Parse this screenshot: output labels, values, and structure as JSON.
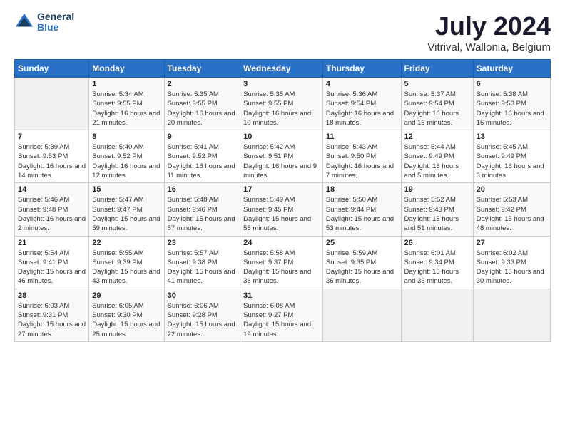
{
  "logo": {
    "line1": "General",
    "line2": "Blue"
  },
  "title": "July 2024",
  "subtitle": "Vitrival, Wallonia, Belgium",
  "headers": [
    "Sunday",
    "Monday",
    "Tuesday",
    "Wednesday",
    "Thursday",
    "Friday",
    "Saturday"
  ],
  "weeks": [
    [
      {
        "day": "",
        "sunrise": "",
        "sunset": "",
        "daylight": ""
      },
      {
        "day": "1",
        "sunrise": "Sunrise: 5:34 AM",
        "sunset": "Sunset: 9:55 PM",
        "daylight": "Daylight: 16 hours and 21 minutes."
      },
      {
        "day": "2",
        "sunrise": "Sunrise: 5:35 AM",
        "sunset": "Sunset: 9:55 PM",
        "daylight": "Daylight: 16 hours and 20 minutes."
      },
      {
        "day": "3",
        "sunrise": "Sunrise: 5:35 AM",
        "sunset": "Sunset: 9:55 PM",
        "daylight": "Daylight: 16 hours and 19 minutes."
      },
      {
        "day": "4",
        "sunrise": "Sunrise: 5:36 AM",
        "sunset": "Sunset: 9:54 PM",
        "daylight": "Daylight: 16 hours and 18 minutes."
      },
      {
        "day": "5",
        "sunrise": "Sunrise: 5:37 AM",
        "sunset": "Sunset: 9:54 PM",
        "daylight": "Daylight: 16 hours and 16 minutes."
      },
      {
        "day": "6",
        "sunrise": "Sunrise: 5:38 AM",
        "sunset": "Sunset: 9:53 PM",
        "daylight": "Daylight: 16 hours and 15 minutes."
      }
    ],
    [
      {
        "day": "7",
        "sunrise": "Sunrise: 5:39 AM",
        "sunset": "Sunset: 9:53 PM",
        "daylight": "Daylight: 16 hours and 14 minutes."
      },
      {
        "day": "8",
        "sunrise": "Sunrise: 5:40 AM",
        "sunset": "Sunset: 9:52 PM",
        "daylight": "Daylight: 16 hours and 12 minutes."
      },
      {
        "day": "9",
        "sunrise": "Sunrise: 5:41 AM",
        "sunset": "Sunset: 9:52 PM",
        "daylight": "Daylight: 16 hours and 11 minutes."
      },
      {
        "day": "10",
        "sunrise": "Sunrise: 5:42 AM",
        "sunset": "Sunset: 9:51 PM",
        "daylight": "Daylight: 16 hours and 9 minutes."
      },
      {
        "day": "11",
        "sunrise": "Sunrise: 5:43 AM",
        "sunset": "Sunset: 9:50 PM",
        "daylight": "Daylight: 16 hours and 7 minutes."
      },
      {
        "day": "12",
        "sunrise": "Sunrise: 5:44 AM",
        "sunset": "Sunset: 9:49 PM",
        "daylight": "Daylight: 16 hours and 5 minutes."
      },
      {
        "day": "13",
        "sunrise": "Sunrise: 5:45 AM",
        "sunset": "Sunset: 9:49 PM",
        "daylight": "Daylight: 16 hours and 3 minutes."
      }
    ],
    [
      {
        "day": "14",
        "sunrise": "Sunrise: 5:46 AM",
        "sunset": "Sunset: 9:48 PM",
        "daylight": "Daylight: 16 hours and 2 minutes."
      },
      {
        "day": "15",
        "sunrise": "Sunrise: 5:47 AM",
        "sunset": "Sunset: 9:47 PM",
        "daylight": "Daylight: 15 hours and 59 minutes."
      },
      {
        "day": "16",
        "sunrise": "Sunrise: 5:48 AM",
        "sunset": "Sunset: 9:46 PM",
        "daylight": "Daylight: 15 hours and 57 minutes."
      },
      {
        "day": "17",
        "sunrise": "Sunrise: 5:49 AM",
        "sunset": "Sunset: 9:45 PM",
        "daylight": "Daylight: 15 hours and 55 minutes."
      },
      {
        "day": "18",
        "sunrise": "Sunrise: 5:50 AM",
        "sunset": "Sunset: 9:44 PM",
        "daylight": "Daylight: 15 hours and 53 minutes."
      },
      {
        "day": "19",
        "sunrise": "Sunrise: 5:52 AM",
        "sunset": "Sunset: 9:43 PM",
        "daylight": "Daylight: 15 hours and 51 minutes."
      },
      {
        "day": "20",
        "sunrise": "Sunrise: 5:53 AM",
        "sunset": "Sunset: 9:42 PM",
        "daylight": "Daylight: 15 hours and 48 minutes."
      }
    ],
    [
      {
        "day": "21",
        "sunrise": "Sunrise: 5:54 AM",
        "sunset": "Sunset: 9:41 PM",
        "daylight": "Daylight: 15 hours and 46 minutes."
      },
      {
        "day": "22",
        "sunrise": "Sunrise: 5:55 AM",
        "sunset": "Sunset: 9:39 PM",
        "daylight": "Daylight: 15 hours and 43 minutes."
      },
      {
        "day": "23",
        "sunrise": "Sunrise: 5:57 AM",
        "sunset": "Sunset: 9:38 PM",
        "daylight": "Daylight: 15 hours and 41 minutes."
      },
      {
        "day": "24",
        "sunrise": "Sunrise: 5:58 AM",
        "sunset": "Sunset: 9:37 PM",
        "daylight": "Daylight: 15 hours and 38 minutes."
      },
      {
        "day": "25",
        "sunrise": "Sunrise: 5:59 AM",
        "sunset": "Sunset: 9:35 PM",
        "daylight": "Daylight: 15 hours and 36 minutes."
      },
      {
        "day": "26",
        "sunrise": "Sunrise: 6:01 AM",
        "sunset": "Sunset: 9:34 PM",
        "daylight": "Daylight: 15 hours and 33 minutes."
      },
      {
        "day": "27",
        "sunrise": "Sunrise: 6:02 AM",
        "sunset": "Sunset: 9:33 PM",
        "daylight": "Daylight: 15 hours and 30 minutes."
      }
    ],
    [
      {
        "day": "28",
        "sunrise": "Sunrise: 6:03 AM",
        "sunset": "Sunset: 9:31 PM",
        "daylight": "Daylight: 15 hours and 27 minutes."
      },
      {
        "day": "29",
        "sunrise": "Sunrise: 6:05 AM",
        "sunset": "Sunset: 9:30 PM",
        "daylight": "Daylight: 15 hours and 25 minutes."
      },
      {
        "day": "30",
        "sunrise": "Sunrise: 6:06 AM",
        "sunset": "Sunset: 9:28 PM",
        "daylight": "Daylight: 15 hours and 22 minutes."
      },
      {
        "day": "31",
        "sunrise": "Sunrise: 6:08 AM",
        "sunset": "Sunset: 9:27 PM",
        "daylight": "Daylight: 15 hours and 19 minutes."
      },
      {
        "day": "",
        "sunrise": "",
        "sunset": "",
        "daylight": ""
      },
      {
        "day": "",
        "sunrise": "",
        "sunset": "",
        "daylight": ""
      },
      {
        "day": "",
        "sunrise": "",
        "sunset": "",
        "daylight": ""
      }
    ]
  ]
}
